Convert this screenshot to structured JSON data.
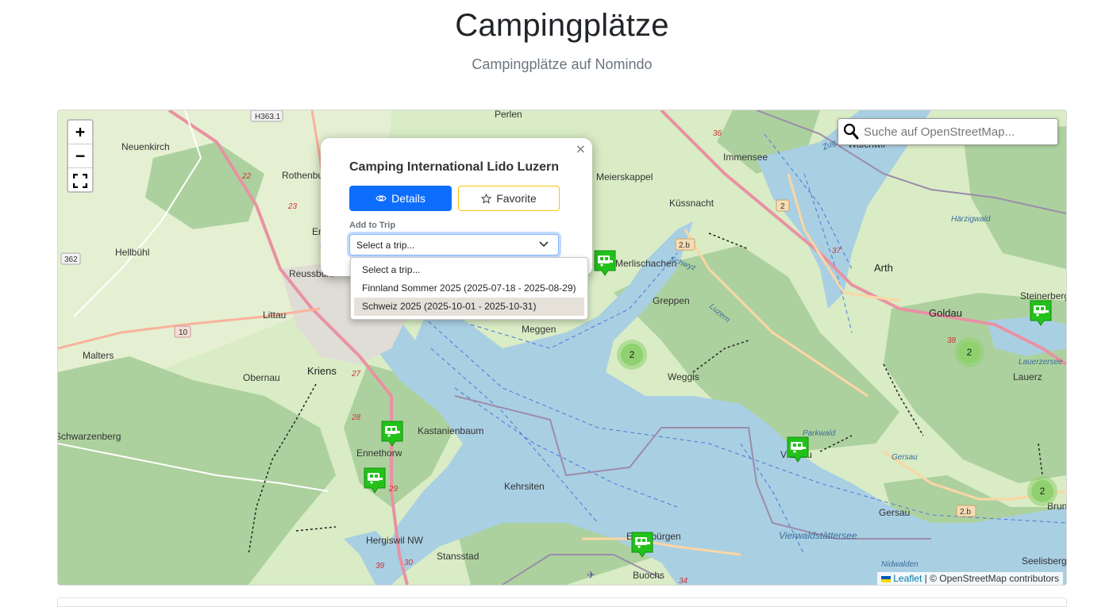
{
  "header": {
    "title": "Campingplätze",
    "subtitle": "Campingplätze auf Nomindo"
  },
  "map": {
    "zoom_in_label": "+",
    "zoom_out_label": "−",
    "fullscreen_icon": "fullscreen-icon",
    "search": {
      "placeholder": "Suche auf OpenStreetMap...",
      "icon": "search-icon"
    },
    "attribution": {
      "leaflet_label": "Leaflet",
      "separator": " | © OpenStreetMap contributors"
    },
    "colors": {
      "water": "#a9cfe3",
      "forest": "#add19e",
      "meadow": "#cdebb0",
      "marker": "#22c21b",
      "cluster": "#8ed16e"
    },
    "places": [
      {
        "name": "Neuenkirch"
      },
      {
        "name": "Rothenburg"
      },
      {
        "name": "Hellbühl"
      },
      {
        "name": "Reussbühl"
      },
      {
        "name": "Littau"
      },
      {
        "name": "Malters"
      },
      {
        "name": "Obernau"
      },
      {
        "name": "Kriens"
      },
      {
        "name": "Schwarzenberg"
      },
      {
        "name": "Ennethorw"
      },
      {
        "name": "Kastanienbaum"
      },
      {
        "name": "Hergiswil NW"
      },
      {
        "name": "Stansstad"
      },
      {
        "name": "Kehrsiten"
      },
      {
        "name": "Ennetbürgen"
      },
      {
        "name": "Buochs"
      },
      {
        "name": "Meggen"
      },
      {
        "name": "Greppen"
      },
      {
        "name": "Weggis"
      },
      {
        "name": "Küssnacht"
      },
      {
        "name": "Immensee"
      },
      {
        "name": "Walchwil"
      },
      {
        "name": "Arth"
      },
      {
        "name": "Goldau"
      },
      {
        "name": "Steinerberg"
      },
      {
        "name": "Lauerz"
      },
      {
        "name": "Gersau"
      },
      {
        "name": "Vitznau"
      },
      {
        "name": "Seelisberg"
      },
      {
        "name": "Perlen"
      },
      {
        "name": "Merlischachen"
      },
      {
        "name": "Meierskappel"
      },
      {
        "name": "Emmen"
      },
      {
        "name": "Brunnen"
      },
      {
        "name": "Härzigwald"
      },
      {
        "name": "Nidwalden"
      },
      {
        "name": "Parkwald"
      }
    ],
    "waters": [
      {
        "name": "Vierwaldstättersee"
      },
      {
        "name": "Lauerzersee"
      },
      {
        "name": "Luzern"
      },
      {
        "name": "Schwyz"
      },
      {
        "name": "Zug"
      },
      {
        "name": "Gersau"
      }
    ],
    "road_labels": [
      "H363.1",
      "22",
      "23",
      "362",
      "10",
      "27",
      "28",
      "29",
      "30",
      "39",
      "36",
      "37",
      "38",
      "34",
      "2",
      "2.b"
    ],
    "clusters": [
      {
        "count": "2"
      },
      {
        "count": "2"
      },
      {
        "count": "2"
      }
    ]
  },
  "popup": {
    "title": "Camping International Lido Luzern",
    "details_label": "Details",
    "favorite_label": "Favorite",
    "close_label": "×",
    "add_to_trip_label": "Add to Trip",
    "select_value": "Select a trip...",
    "options": [
      "Select a trip...",
      "Finnland Sommer 2025 (2025-07-18 - 2025-08-29)",
      "Schweiz 2025 (2025-10-01 - 2025-10-31)"
    ],
    "highlighted_option": 2
  }
}
